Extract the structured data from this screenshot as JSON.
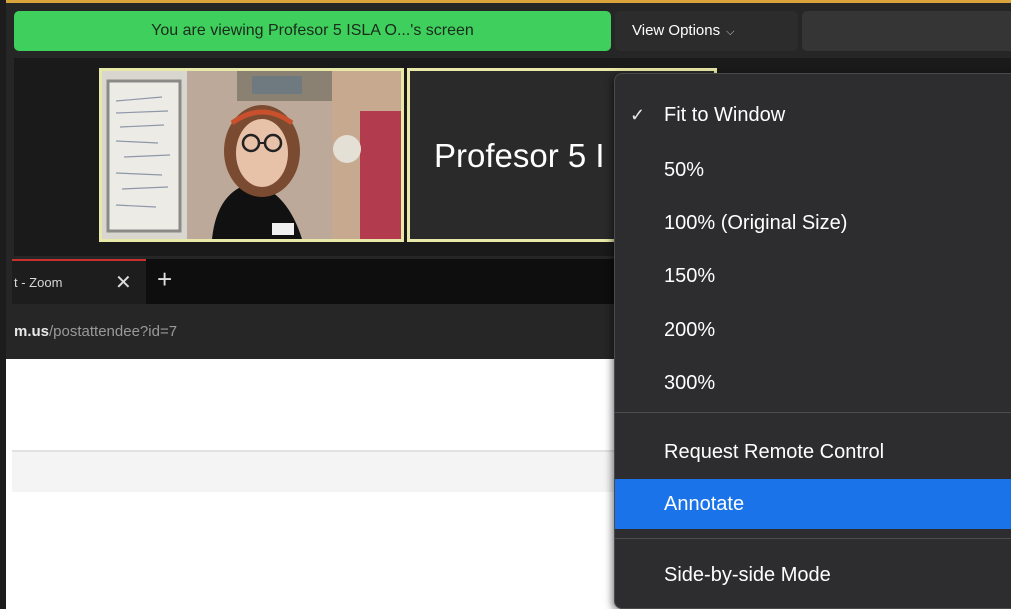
{
  "banner": {
    "sharing_text": "You are viewing Profesor 5 ISLA O...'s screen",
    "view_options_label": "View Options",
    "view_options_chevron": "chevron-down-icon"
  },
  "video": {
    "participant_name": "Profesor 5 I"
  },
  "browser": {
    "tab_title": "t - Zoom",
    "close_glyph": "✕",
    "new_tab_glyph": "+",
    "url_domain": "m.us",
    "url_path": "/postattendee?id=7"
  },
  "menu": {
    "items": [
      {
        "label": "Fit to Window",
        "checked": true
      },
      {
        "label": "50%"
      },
      {
        "label": "100% (Original Size)"
      },
      {
        "label": "150%"
      },
      {
        "label": "200%"
      },
      {
        "label": "300%"
      },
      {
        "label": "Request Remote Control"
      },
      {
        "label": "Annotate",
        "active": true
      },
      {
        "label": "Side-by-side Mode"
      }
    ],
    "check_glyph": "✓"
  },
  "colors": {
    "banner_green": "#3fcf5d",
    "menu_bg": "#2d2d2f",
    "highlight_blue": "#1a73e8",
    "tab_accent_red": "#c9302c"
  }
}
